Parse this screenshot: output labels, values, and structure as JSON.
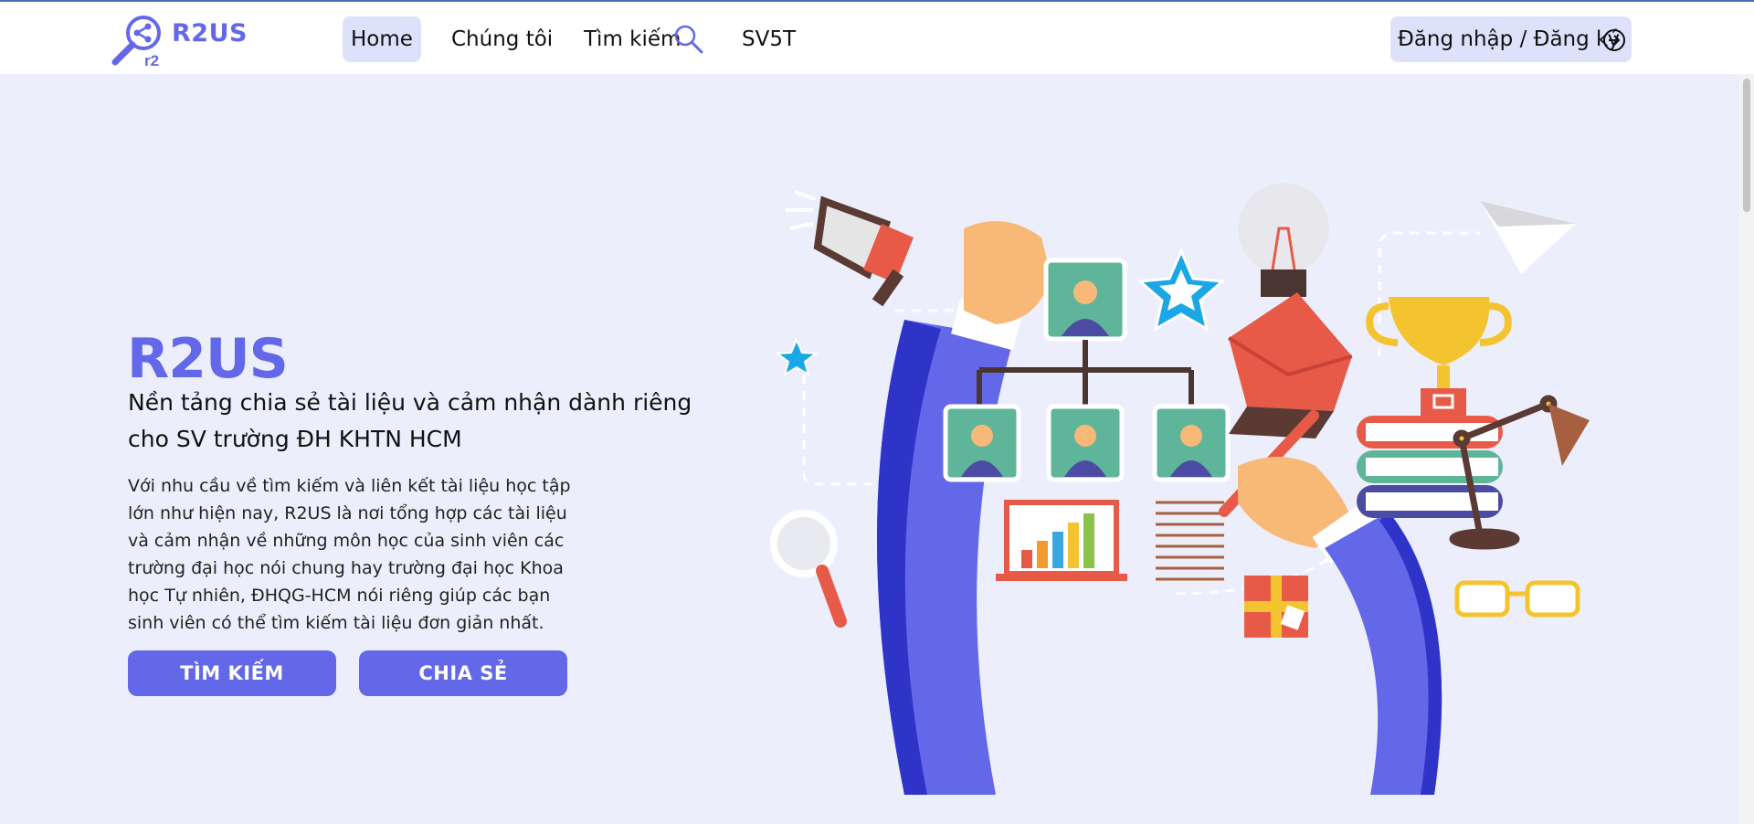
{
  "brand": {
    "name": "R2US",
    "logo_sub": "r2"
  },
  "nav": {
    "home": "Home",
    "about": "Chúng tôi",
    "search": "Tìm kiếm",
    "sv5t": "SV5T"
  },
  "auth": {
    "login_label": "Đăng nhập / Đăng ký"
  },
  "hero": {
    "title": "R2US",
    "subtitle": "Nền tảng chia sẻ tài liệu và cảm nhận dành riêng cho SV trường ĐH KHTN HCM",
    "description": "Với nhu cầu về tìm kiếm và liên kết tài liệu học tập lớn như hiện nay, R2US là nơi tổng hợp các tài liệu và cảm nhận về những môn học của sinh viên các trường đại học nói chung hay trường đại học Khoa học Tự nhiên, ĐHQG-HCM nói riêng giúp các bạn sinh viên có thể tìm kiếm tài liệu đơn giản nhất.",
    "search_button": "TÌM KIẾM",
    "share_button": "CHIA SẺ"
  },
  "colors": {
    "accent": "#6368e8",
    "nav_active_bg": "#dde2fb",
    "page_bg": "#eceffb"
  },
  "icons": {
    "logo": "share-magnifier-icon",
    "search": "search-icon",
    "login": "arrow-right-circle-icon"
  }
}
